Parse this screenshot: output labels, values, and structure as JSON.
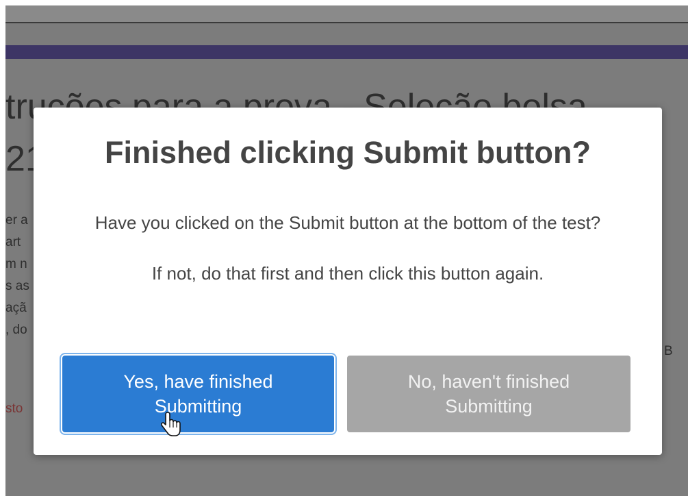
{
  "background": {
    "title_line1": "trucões para a prova - Seleção bolsa",
    "title_line2": "21",
    "text_fragments": [
      "er a",
      "art",
      "m n",
      "s as",
      "açã",
      ", do"
    ],
    "link_fragment": "sto",
    "right_fragment": "B"
  },
  "modal": {
    "title": "Finished clicking Submit button?",
    "question": "Have you clicked on the Submit button at the bottom of the test?",
    "instruction": "If not, do that first and then click this button again.",
    "yes_button": {
      "line1": "Yes, have finished",
      "line2": "Submitting"
    },
    "no_button": {
      "line1": "No, haven't finished",
      "line2": "Submitting"
    }
  },
  "colors": {
    "overlay": "#7c7c7c",
    "purple_bar": "#3d3565",
    "yes_button": "#2b7cd3",
    "no_button": "#a6a6a6",
    "modal_bg": "#ffffff"
  },
  "icons": {
    "pointer": "hand-pointer-icon"
  }
}
